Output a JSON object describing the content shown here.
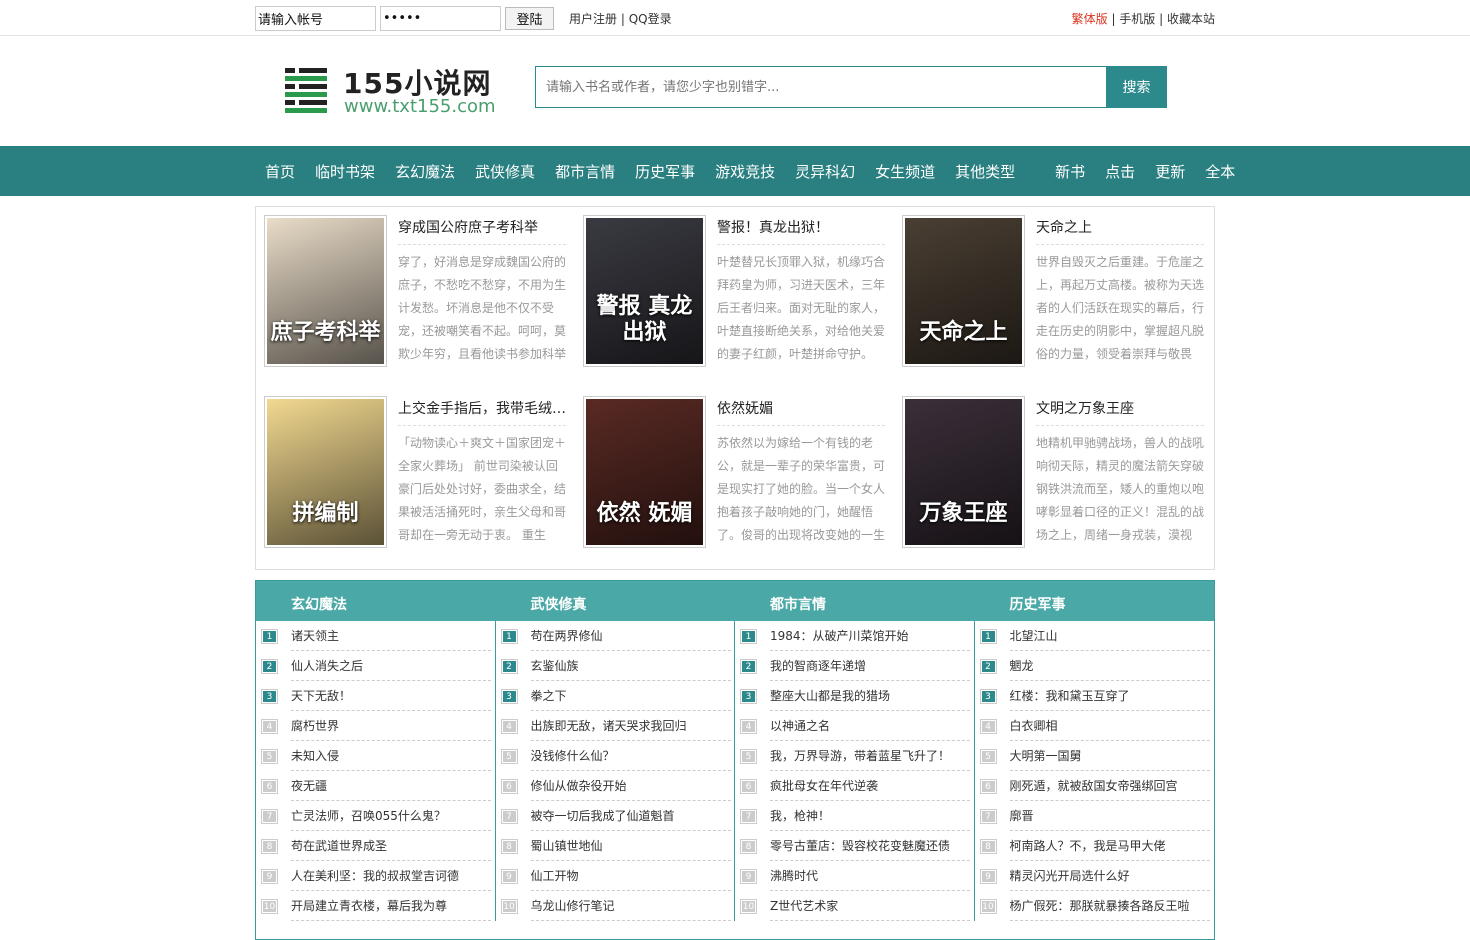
{
  "topbar": {
    "account_value": "请输入帐号",
    "password_value": "•••••",
    "login_label": "登陆",
    "register": "用户注册",
    "qq_login": "QQ登录",
    "traditional": "繁体版",
    "mobile": "手机版",
    "bookmark": "收藏本站",
    "sep": " | "
  },
  "header": {
    "logo_title": "155小说网",
    "logo_url": "www.txt155.com",
    "search_placeholder": "请输入书名或作者，请您少字也别错字...",
    "search_label": "搜索"
  },
  "colors": {
    "brand": "#2a7f81",
    "list_head": "#4aa8a6",
    "accent_red": "#dd3322"
  },
  "nav": {
    "main": [
      "首页",
      "临时书架",
      "玄幻魔法",
      "武侠修真",
      "都市言情",
      "历史军事",
      "游戏竞技",
      "灵异科幻",
      "女生频道",
      "其他类型"
    ],
    "sub": [
      "新书",
      "点击",
      "更新",
      "全本"
    ]
  },
  "featured": [
    {
      "title": "穿成国公府庶子考科举",
      "desc": "穿了，好消息是穿成魏国公府的庶子，不愁吃不愁穿，不用为生计发愁。坏消息是他不仅不受宠，还被嘲笑看不起。呵呵，莫欺少年穷，且看他读书参加科举",
      "cover_text": "庶子考科举",
      "cover_color": "#e9dcc8"
    },
    {
      "title": "警报！真龙出狱！",
      "desc": "叶楚替兄长顶罪入狱，机缘巧合拜药皇为师，习进天医术，三年后王者归来。面对无耻的家人，叶楚直接断绝关系，对给他关爱的妻子红颜，叶楚拼命守护。",
      "cover_text": "警报 真龙出狱",
      "cover_color": "#3a3a42"
    },
    {
      "title": "天命之上",
      "desc": "世界自毁灭之后重建。于危崖之上，再起万丈高楼。被称为天选者的人们活跃在现实的幕后，行走在历史的阴影中，掌握超凡脱俗的力量，领受着崇拜与敬畏",
      "cover_text": "天命之上",
      "cover_color": "#4a3f33"
    },
    {
      "title": "上交金手指后，我带毛绒绒们出道了",
      "desc": "「动物读心＋爽文＋国家团宠＋全家火葬场」 前世司染被认回豪门后处处讨好，委曲求全，结果被活活捅死时，亲生父母和哥哥却在一旁无动于衷。 重生",
      "cover_text": "拼编制",
      "cover_color": "#f2d990"
    },
    {
      "title": "依然妩媚",
      "desc": "苏依然以为嫁给一个有钱的老公，就是一辈子的荣华富贵，可是现实打了她的脸。当一个女人抱着孩子敲响她的门，她醒悟了。俊哥的出现将改变她的一生",
      "cover_text": "依然 妩媚",
      "cover_color": "#5a2a24"
    },
    {
      "title": "文明之万象王座",
      "desc": "地精机甲驰骋战场，兽人的战吼响彻天际，精灵的魔法箭矢穿破钢铁洪流而至，矮人的重炮以咆哮彰显着口径的正义！混乱的战场之上，周绪一身戎装，漠视",
      "cover_text": "万象王座",
      "cover_color": "#3b2f3a"
    }
  ],
  "lists": [
    {
      "title": "玄幻魔法",
      "items": [
        "诸天领主",
        "仙人消失之后",
        "天下无敌！",
        "腐朽世界",
        "未知入侵",
        "夜无疆",
        "亡灵法师，召唤055什么鬼？",
        "苟在武道世界成圣",
        "人在美利坚：我的叔叔堂吉诃德",
        "开局建立青衣楼，幕后我为尊"
      ]
    },
    {
      "title": "武侠修真",
      "items": [
        "苟在两界修仙",
        "玄鉴仙族",
        "拳之下",
        "出族即无敌，诸天哭求我回归",
        "没钱修什么仙？",
        "修仙从做杂役开始",
        "被夺一切后我成了仙道魁首",
        "蜀山镇世地仙",
        "仙工开物",
        "乌龙山修行笔记"
      ]
    },
    {
      "title": "都市言情",
      "items": [
        "1984：从破产川菜馆开始",
        "我的智商逐年递增",
        "整座大山都是我的猎场",
        "以神通之名",
        "我，万界导游，带着蓝星飞升了！",
        "疯批母女在年代逆袭",
        "我，枪神！",
        "零号古董店：毁容校花变魅魔还债",
        "沸腾时代",
        "Z世代艺术家"
      ]
    },
    {
      "title": "历史军事",
      "items": [
        "北望江山",
        "魍龙",
        "红楼：我和黛玉互穿了",
        "白衣卿相",
        "大明第一国舅",
        "刚死遁，就被敌国女帝强绑回宫",
        "廓晋",
        "柯南路人？不，我是马甲大佬",
        "精灵闪光开局选什么好",
        "杨广假死：那朕就暴揍各路反王啦"
      ]
    }
  ],
  "rank_numbers": [
    "1",
    "2",
    "3",
    "4",
    "5",
    "6",
    "7",
    "8",
    "9",
    "10"
  ]
}
